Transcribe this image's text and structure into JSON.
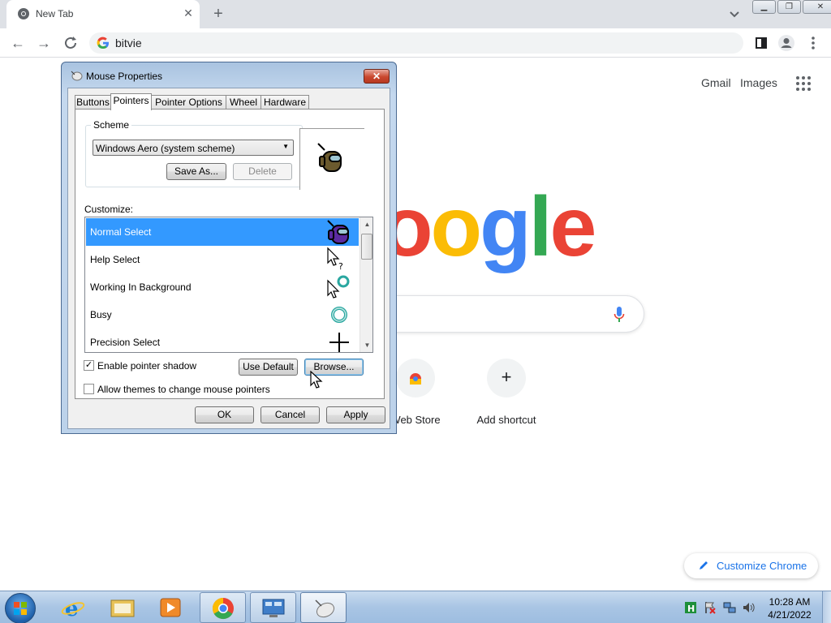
{
  "browser": {
    "tab_title": "New Tab",
    "omnibox_text": "bitvie"
  },
  "ntp": {
    "gmail": "Gmail",
    "images": "Images",
    "logo_visible": "oogle",
    "shortcuts": [
      {
        "label": "Web Store"
      },
      {
        "label": "Add shortcut"
      }
    ],
    "customize_label": "Customize Chrome"
  },
  "dialog": {
    "title": "Mouse Properties",
    "tabs": [
      "Buttons",
      "Pointers",
      "Pointer Options",
      "Wheel",
      "Hardware"
    ],
    "active_tab": "Pointers",
    "scheme_label": "Scheme",
    "scheme_value": "Windows Aero (system scheme)",
    "save_as": "Save As...",
    "delete": "Delete",
    "customize_label": "Customize:",
    "pointers": [
      {
        "label": "Normal Select",
        "selected": true
      },
      {
        "label": "Help Select"
      },
      {
        "label": "Working In Background"
      },
      {
        "label": "Busy"
      },
      {
        "label": "Precision Select"
      }
    ],
    "enable_shadow": "Enable pointer shadow",
    "allow_themes": "Allow themes to change mouse pointers",
    "use_default": "Use Default",
    "browse": "Browse...",
    "ok": "OK",
    "cancel": "Cancel",
    "apply": "Apply"
  },
  "taskbar": {
    "time": "10:28 AM",
    "date": "4/21/2022"
  },
  "colors": {
    "google_blue": "#4285f4",
    "google_red": "#ea4335",
    "google_yellow": "#fbbc05",
    "google_green": "#34a853",
    "selection": "#3399ff"
  }
}
